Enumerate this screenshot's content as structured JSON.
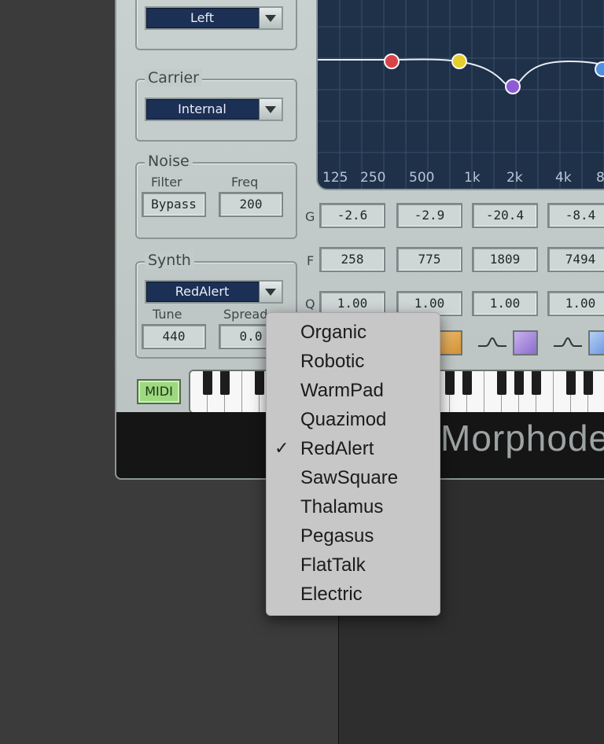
{
  "modulator_group": {
    "dropdown_value": "Left"
  },
  "carrier_group": {
    "title": "Carrier",
    "dropdown_value": "Internal"
  },
  "noise_group": {
    "title": "Noise",
    "filter_label": "Filter",
    "filter_value": "Bypass",
    "freq_label": "Freq",
    "freq_value": "200"
  },
  "synth_group": {
    "title": "Synth",
    "dropdown_value": "RedAlert",
    "tune_label": "Tune",
    "tune_value": "440",
    "spread_label": "Spread",
    "spread_value": "0.0"
  },
  "eq": {
    "freq_ticks": [
      "125",
      "250",
      "500",
      "1k",
      "2k",
      "4k",
      "8"
    ],
    "row_labels": {
      "gain": "G",
      "freq": "F",
      "q": "Q"
    },
    "bands": [
      {
        "gain": "-2.6",
        "freq": "258",
        "q": "1.00"
      },
      {
        "gain": "-2.9",
        "freq": "775",
        "q": "1.00"
      },
      {
        "gain": "-20.4",
        "freq": "1809",
        "q": "1.00"
      },
      {
        "gain": "-8.4",
        "freq": "7494",
        "q": "1.00"
      }
    ],
    "node_colors": [
      "#d8434a",
      "#e6cf2c",
      "#8d5bd6",
      "#4f8fe0"
    ],
    "swatch_colors": [
      "#e3a64a",
      "#a88ad6",
      "#7fa8e6"
    ]
  },
  "midi_button": "MIDI",
  "brand_name": "Morphode",
  "synth_menu": {
    "items": [
      {
        "label": "Organic",
        "check": ""
      },
      {
        "label": "Robotic",
        "check": ""
      },
      {
        "label": "WarmPad",
        "check": ""
      },
      {
        "label": "Quazimod",
        "check": ""
      },
      {
        "label": "RedAlert",
        "check": "✓"
      },
      {
        "label": "SawSquare",
        "check": ""
      },
      {
        "label": "Thalamus",
        "check": ""
      },
      {
        "label": "Pegasus",
        "check": ""
      },
      {
        "label": "FlatTalk",
        "check": ""
      },
      {
        "label": "Electric",
        "check": ""
      }
    ],
    "selected": "RedAlert"
  }
}
